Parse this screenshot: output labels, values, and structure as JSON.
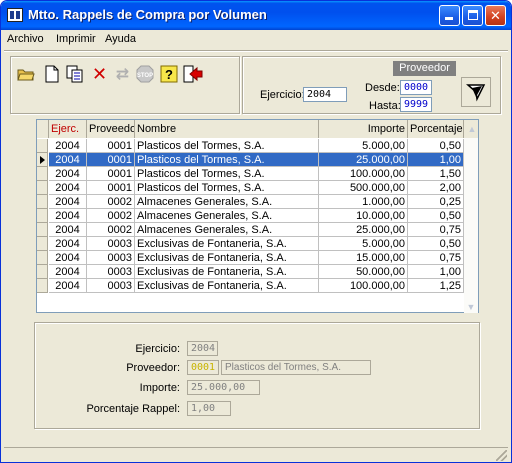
{
  "window": {
    "title": "Mtto. Rappels de Compra por Volumen"
  },
  "menu": {
    "archivo": "Archivo",
    "imprimir": "Imprimir",
    "ayuda": "Ayuda"
  },
  "filter": {
    "ejercicio_label": "Ejercicio:",
    "ejercicio_value": "2004",
    "proveedor_header": "Proveedor",
    "desde_label": "Desde:",
    "desde_value": "0000",
    "hasta_label": "Hasta:",
    "hasta_value": "9999"
  },
  "grid": {
    "columns": [
      "Ejerc.",
      "Proveedor",
      "Nombre",
      "Importe",
      "Porcentaje"
    ],
    "selected_row": 1,
    "rows": [
      {
        "ejercicio": "2004",
        "proveedor": "0001",
        "nombre": "Plasticos del Tormes, S.A.",
        "importe": "5.000,00",
        "porcentaje": "0,50"
      },
      {
        "ejercicio": "2004",
        "proveedor": "0001",
        "nombre": "Plasticos del Tormes, S.A.",
        "importe": "25.000,00",
        "porcentaje": "1,00"
      },
      {
        "ejercicio": "2004",
        "proveedor": "0001",
        "nombre": "Plasticos del Tormes, S.A.",
        "importe": "100.000,00",
        "porcentaje": "1,50"
      },
      {
        "ejercicio": "2004",
        "proveedor": "0001",
        "nombre": "Plasticos del Tormes, S.A.",
        "importe": "500.000,00",
        "porcentaje": "2,00"
      },
      {
        "ejercicio": "2004",
        "proveedor": "0002",
        "nombre": "Almacenes Generales, S.A.",
        "importe": "1.000,00",
        "porcentaje": "0,25"
      },
      {
        "ejercicio": "2004",
        "proveedor": "0002",
        "nombre": "Almacenes Generales, S.A.",
        "importe": "10.000,00",
        "porcentaje": "0,50"
      },
      {
        "ejercicio": "2004",
        "proveedor": "0002",
        "nombre": "Almacenes Generales, S.A.",
        "importe": "25.000,00",
        "porcentaje": "0,75"
      },
      {
        "ejercicio": "2004",
        "proveedor": "0003",
        "nombre": "Exclusivas de Fontaneria, S.A.",
        "importe": "5.000,00",
        "porcentaje": "0,50"
      },
      {
        "ejercicio": "2004",
        "proveedor": "0003",
        "nombre": "Exclusivas de Fontaneria, S.A.",
        "importe": "15.000,00",
        "porcentaje": "0,75"
      },
      {
        "ejercicio": "2004",
        "proveedor": "0003",
        "nombre": "Exclusivas de Fontaneria, S.A.",
        "importe": "50.000,00",
        "porcentaje": "1,00"
      },
      {
        "ejercicio": "2004",
        "proveedor": "0003",
        "nombre": "Exclusivas de Fontaneria, S.A.",
        "importe": "100.000,00",
        "porcentaje": "1,25"
      }
    ]
  },
  "detail": {
    "ejercicio_label": "Ejercicio:",
    "ejercicio_value": "2004",
    "proveedor_label": "Proveedor:",
    "proveedor_code": "0001",
    "proveedor_name": "Plasticos del Tormes, S.A.",
    "importe_label": "Importe:",
    "importe_value": "25.000,00",
    "porcentaje_label": "Porcentaje Rappel:",
    "porcentaje_value": "1,00"
  },
  "toolbar": {
    "icons": [
      "open-folder-icon",
      "new-document-icon",
      "copy-icon",
      "delete-icon",
      "undo-icon",
      "stop-icon",
      "help-icon",
      "exit-icon"
    ]
  }
}
